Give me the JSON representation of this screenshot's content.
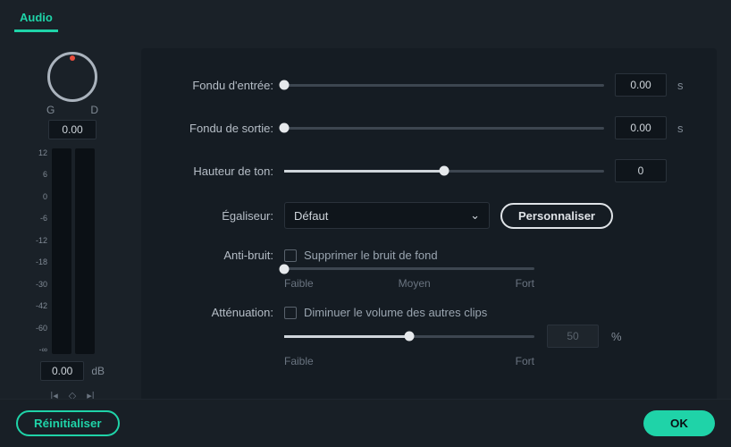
{
  "tabs": {
    "audio": "Audio"
  },
  "pan": {
    "left": "G",
    "right": "D",
    "value": "0.00"
  },
  "meter": {
    "scale": [
      "12",
      "6",
      "0",
      "-6",
      "-12",
      "-18",
      "-30",
      "-42",
      "-60",
      "-∞"
    ],
    "value": "0.00",
    "unit": "dB"
  },
  "rows": {
    "fadein": {
      "label": "Fondu d'entrée:",
      "value": "0.00",
      "unit": "s",
      "pos": 0
    },
    "fadeout": {
      "label": "Fondu de sortie:",
      "value": "0.00",
      "unit": "s",
      "pos": 0
    },
    "pitch": {
      "label": "Hauteur de ton:",
      "value": "0",
      "unit": "",
      "pos": 50
    },
    "equalizer": {
      "label": "Égaliseur:",
      "value": "Défaut",
      "button": "Personnaliser"
    },
    "denoise": {
      "label": "Anti-bruit:",
      "checkbox": "Supprimer le bruit de fond",
      "levels": [
        "Faible",
        "Moyen",
        "Fort"
      ],
      "pos": 0
    },
    "ducking": {
      "label": "Atténuation:",
      "checkbox": "Diminuer le volume des autres clips",
      "levels": [
        "Faible",
        "Fort"
      ],
      "value": "50",
      "unit": "%",
      "pos": 50
    }
  },
  "footer": {
    "reset": "Réinitialiser",
    "ok": "OK"
  }
}
